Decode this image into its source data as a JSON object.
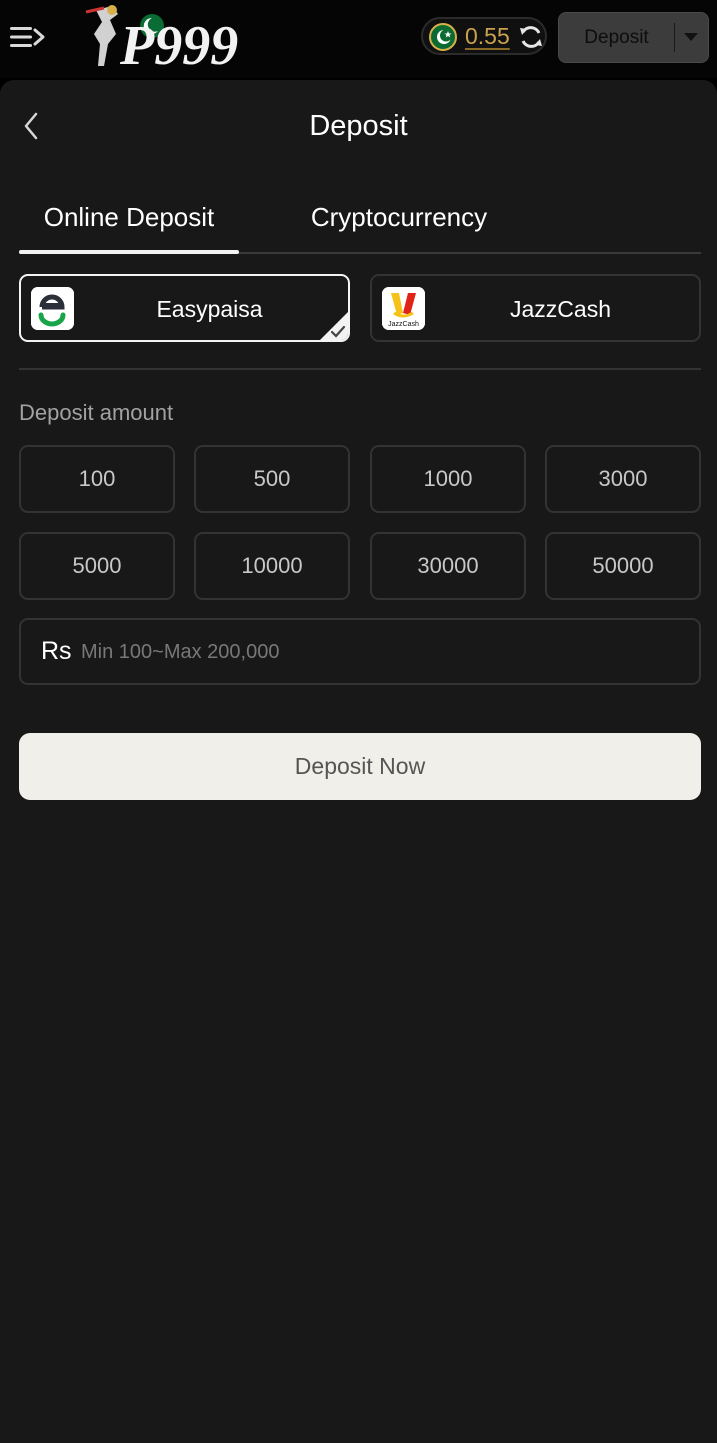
{
  "header": {
    "balance": "0.55",
    "deposit_button_label": "Deposit"
  },
  "page": {
    "title": "Deposit"
  },
  "tabs": [
    {
      "label": "Online Deposit",
      "active": true
    },
    {
      "label": "Cryptocurrency",
      "active": false
    }
  ],
  "payment_methods": [
    {
      "label": "Easypaisa",
      "icon": "easypaisa-logo",
      "selected": true
    },
    {
      "label": "JazzCash",
      "icon": "jazzcash-logo",
      "selected": false
    }
  ],
  "amount": {
    "label": "Deposit amount",
    "presets": [
      "100",
      "500",
      "1000",
      "3000",
      "5000",
      "10000",
      "30000",
      "50000"
    ],
    "currency_symbol": "Rs",
    "placeholder": "Min 100~Max 200,000"
  },
  "submit_label": "Deposit Now",
  "colors": {
    "background": "#181818",
    "topbar": "#050505",
    "balance_gold": "#c9a24c",
    "submit_bg": "#f1efea"
  }
}
